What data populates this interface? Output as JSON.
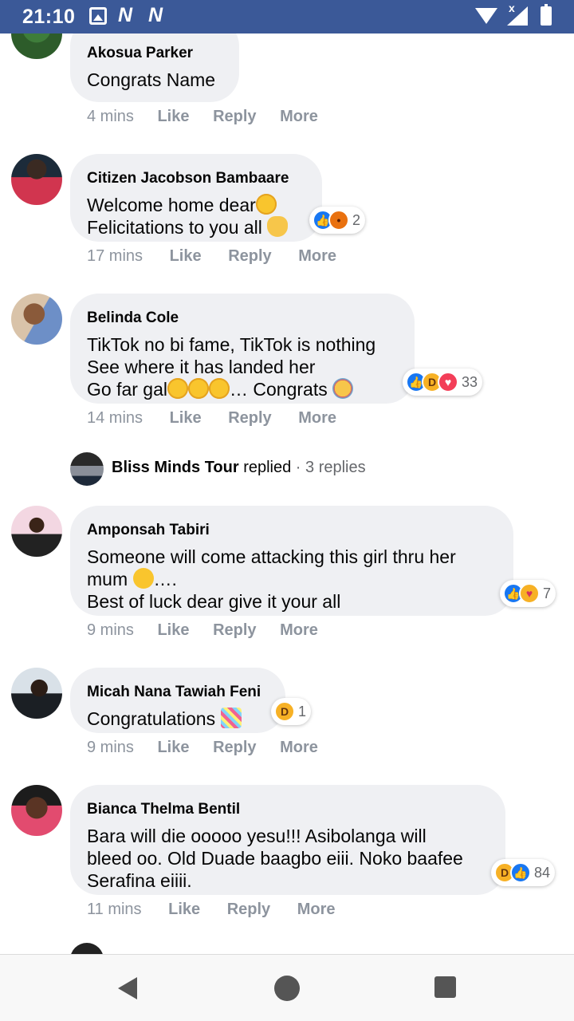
{
  "status_bar": {
    "time": "21:10",
    "n1": "N",
    "n2": "N"
  },
  "comments": [
    {
      "name": "Akosua Parker",
      "text": "Congrats Name",
      "time": "4 mins",
      "like": "Like",
      "reply": "Reply",
      "more": "More"
    },
    {
      "name": "Citizen Jacobson Bambaare",
      "line1": "Welcome home dear",
      "line2": "Felicitations to you all ",
      "reaction_count": "2",
      "time": "17 mins",
      "like": "Like",
      "reply": "Reply",
      "more": "More"
    },
    {
      "name": "Belinda Cole",
      "line1": "TikTok no bi fame, TikTok is nothing",
      "line2": "See where it has landed her",
      "line3a": "Go far gal",
      "line3b": "… Congrats ",
      "reaction_count": "33",
      "time": "14 mins",
      "like": "Like",
      "reply": "Reply",
      "more": "More"
    },
    {
      "name": "Amponsah Tabiri",
      "line1": "Someone will come attacking this girl thru her",
      "line2a": "mum ",
      "line2b": "….",
      "line3": "Best of luck dear give it your all",
      "reaction_count": "7",
      "time": "9 mins",
      "like": "Like",
      "reply": "Reply",
      "more": "More"
    },
    {
      "name": "Micah Nana Tawiah Feni",
      "text": "Congratulations ",
      "reaction_count": "1",
      "time": "9 mins",
      "like": "Like",
      "reply": "Reply",
      "more": "More"
    },
    {
      "name": "Bianca Thelma Bentil",
      "text": "Bara will die ooooo yesu!!! Asibolanga will\nbleed oo. Old Duade baagbo eiii. Noko baafee\nSerafina eiiii.",
      "reaction_count": "84",
      "time": "11 mins",
      "like": "Like",
      "reply": "Reply",
      "more": "More"
    }
  ],
  "replies_row": {
    "name": "Bliss Minds Tour",
    "action": " replied",
    "count": "3 replies"
  },
  "colors": {
    "status_bar": "#3b5998",
    "bubble": "#eff0f3",
    "muted": "#8d949e",
    "like_blue": "#1877f2"
  }
}
